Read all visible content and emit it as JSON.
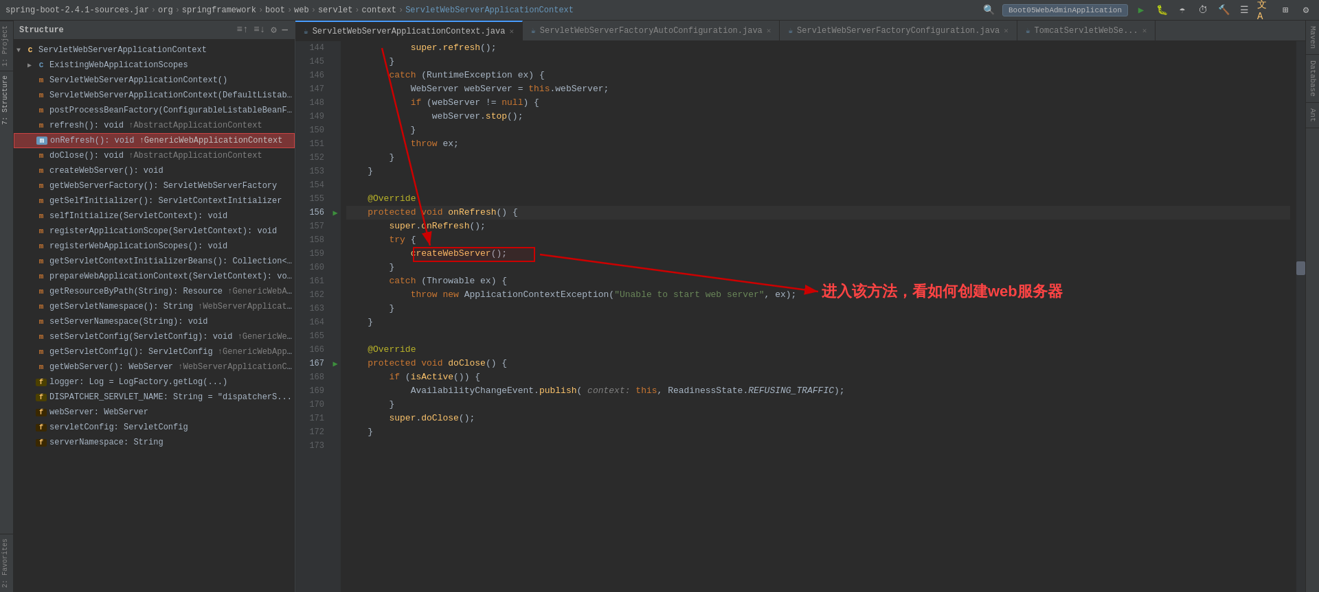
{
  "topbar": {
    "breadcrumbs": [
      "spring-boot-2.4.1-sources.jar",
      "org",
      "springframework",
      "boot",
      "web",
      "servlet",
      "context",
      "ServletWebServerApplicationContext"
    ],
    "run_config": "Boot05WebAdminApplication",
    "icons": [
      "play",
      "debug",
      "coverage",
      "profile",
      "run-stop",
      "build",
      "tasks",
      "translate",
      "window",
      "settings"
    ]
  },
  "structure_panel": {
    "title": "Structure",
    "root": "ServletWebServerApplicationContext",
    "items": [
      {
        "indent": 1,
        "icon": "arrow",
        "type": "class",
        "text": "ExistingWebApplicationScopes",
        "selected": false
      },
      {
        "indent": 1,
        "icon": "m",
        "text": "ServletWebServerApplicationContext()",
        "selected": false
      },
      {
        "indent": 1,
        "icon": "m",
        "text": "ServletWebServerApplicationContext(DefaultListabl...",
        "selected": false
      },
      {
        "indent": 1,
        "icon": "m",
        "text": "postProcessBeanFactory(ConfigurableListableBeanFa...",
        "selected": false
      },
      {
        "indent": 1,
        "icon": "m",
        "text": "refresh(): void ↑AbstractApplicationContext",
        "selected": false,
        "highlighted": false
      },
      {
        "indent": 1,
        "icon": "m",
        "text": "onRefresh(): void ↑GenericWebApplicationContext",
        "selected": true,
        "highlighted": true
      },
      {
        "indent": 1,
        "icon": "m",
        "text": "doClose(): void ↑AbstractApplicationContext",
        "selected": false
      },
      {
        "indent": 1,
        "icon": "m",
        "text": "createWebServer(): void",
        "selected": false
      },
      {
        "indent": 1,
        "icon": "m",
        "text": "getWebServerFactory(): ServletWebServerFactory",
        "selected": false
      },
      {
        "indent": 1,
        "icon": "m",
        "text": "getSelfInitializer(): ServletContextInitializer",
        "selected": false
      },
      {
        "indent": 1,
        "icon": "m",
        "text": "selfInitialize(ServletContext): void",
        "selected": false
      },
      {
        "indent": 1,
        "icon": "m",
        "text": "registerApplicationScope(ServletContext): void",
        "selected": false
      },
      {
        "indent": 1,
        "icon": "m",
        "text": "registerWebApplicationScopes(): void",
        "selected": false
      },
      {
        "indent": 1,
        "icon": "m",
        "text": "getServletContextInitializerBeans(): Collection<Serv...",
        "selected": false
      },
      {
        "indent": 1,
        "icon": "m",
        "text": "prepareWebApplicationContext(ServletContext): vo...",
        "selected": false
      },
      {
        "indent": 1,
        "icon": "m",
        "text": "getResourceByPath(String): Resource ↑GenericWebA...",
        "selected": false
      },
      {
        "indent": 1,
        "icon": "m",
        "text": "getServletNamespace(): String ↑WebServerApplicatio...",
        "selected": false
      },
      {
        "indent": 1,
        "icon": "m",
        "text": "setServerNamespace(String): void",
        "selected": false
      },
      {
        "indent": 1,
        "icon": "m",
        "text": "setServletConfig(ServletConfig): void ↑GenericWebA...",
        "selected": false
      },
      {
        "indent": 1,
        "icon": "m",
        "text": "getServletConfig(): ServletConfig ↑GenericWebAppl...",
        "selected": false
      },
      {
        "indent": 1,
        "icon": "m",
        "text": "getWebServer(): WebServer ↑WebServerApplicationC...",
        "selected": false
      },
      {
        "indent": 1,
        "icon": "f",
        "text": "logger: Log = LogFactory.getLog(...)",
        "selected": false
      },
      {
        "indent": 1,
        "icon": "f",
        "text": "DISPATCHER_SERVLET_NAME: String = \"dispatcherS...",
        "selected": false
      },
      {
        "indent": 1,
        "icon": "f",
        "text": "webServer: WebServer",
        "selected": false
      },
      {
        "indent": 1,
        "icon": "f",
        "text": "servletConfig: ServletConfig",
        "selected": false
      },
      {
        "indent": 1,
        "icon": "f",
        "text": "serverNamespace: String",
        "selected": false
      }
    ]
  },
  "tabs": [
    {
      "label": "ServletWebServerApplicationContext.java",
      "active": true,
      "modified": false
    },
    {
      "label": "ServletWebServerFactoryAutoConfiguration.java",
      "active": false,
      "modified": false
    },
    {
      "label": "ServletWebServerFactoryConfiguration.java",
      "active": false,
      "modified": false
    },
    {
      "label": "TomcatServletWebSe...",
      "active": false,
      "modified": false
    }
  ],
  "code_lines": [
    {
      "num": 144,
      "content": "            super.refresh();",
      "gutter": ""
    },
    {
      "num": 145,
      "content": "        }",
      "gutter": ""
    },
    {
      "num": 146,
      "content": "        catch (RuntimeException ex) {",
      "gutter": ""
    },
    {
      "num": 147,
      "content": "            WebServer webServer = this.webServer;",
      "gutter": ""
    },
    {
      "num": 148,
      "content": "            if (webServer != null) {",
      "gutter": ""
    },
    {
      "num": 149,
      "content": "                webServer.stop();",
      "gutter": ""
    },
    {
      "num": 150,
      "content": "            }",
      "gutter": ""
    },
    {
      "num": 151,
      "content": "            throw ex;",
      "gutter": ""
    },
    {
      "num": 152,
      "content": "        }",
      "gutter": ""
    },
    {
      "num": 153,
      "content": "    }",
      "gutter": ""
    },
    {
      "num": 154,
      "content": "",
      "gutter": ""
    },
    {
      "num": 155,
      "content": "    @Override",
      "gutter": ""
    },
    {
      "num": 156,
      "content": "    protected void onRefresh() {",
      "gutter": "run"
    },
    {
      "num": 157,
      "content": "        super.onRefresh();",
      "gutter": ""
    },
    {
      "num": 158,
      "content": "        try {",
      "gutter": ""
    },
    {
      "num": 159,
      "content": "            createWebServer();",
      "gutter": ""
    },
    {
      "num": 160,
      "content": "        }",
      "gutter": ""
    },
    {
      "num": 161,
      "content": "        catch (Throwable ex) {",
      "gutter": ""
    },
    {
      "num": 162,
      "content": "            throw new ApplicationContextException(\"Unable to start web server\", ex);",
      "gutter": ""
    },
    {
      "num": 163,
      "content": "        }",
      "gutter": ""
    },
    {
      "num": 164,
      "content": "    }",
      "gutter": ""
    },
    {
      "num": 165,
      "content": "",
      "gutter": ""
    },
    {
      "num": 166,
      "content": "    @Override",
      "gutter": ""
    },
    {
      "num": 167,
      "content": "    protected void doClose() {",
      "gutter": "run2"
    },
    {
      "num": 168,
      "content": "        if (isActive()) {",
      "gutter": ""
    },
    {
      "num": 169,
      "content": "            AvailabilityChangeEvent.publish( context: this, ReadinessState.REFUSING_TRAFFIC);",
      "gutter": ""
    },
    {
      "num": 170,
      "content": "        }",
      "gutter": ""
    },
    {
      "num": 171,
      "content": "        super.doClose();",
      "gutter": ""
    },
    {
      "num": 172,
      "content": "    }",
      "gutter": ""
    },
    {
      "num": 173,
      "content": "",
      "gutter": ""
    }
  ],
  "annotation": {
    "chinese_text": "进入该方法，看如何创建web服务器",
    "box_label": "createWebServer();"
  },
  "right_panels": [
    "Maven",
    "Database",
    "Ant"
  ],
  "left_vtabs": [
    "1: Project",
    "7: Structure",
    "Favorites"
  ]
}
